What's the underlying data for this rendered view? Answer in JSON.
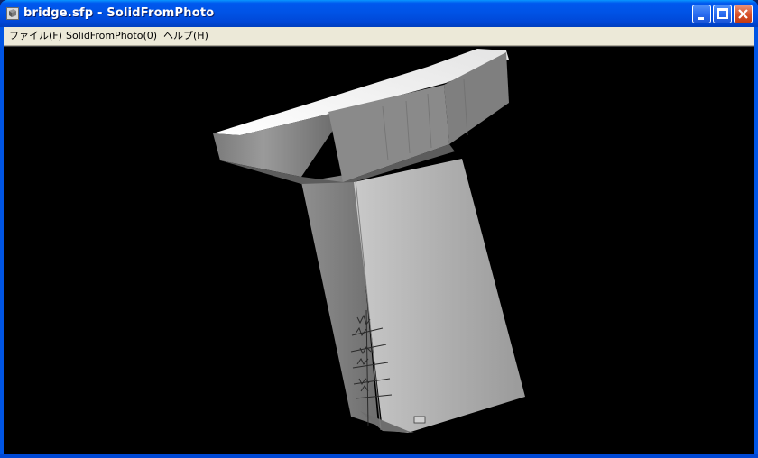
{
  "window": {
    "title": "bridge.sfp - SolidFromPhoto",
    "icon": "app-icon"
  },
  "caption_buttons": {
    "minimize": "minimize-icon",
    "maximize": "maximize-icon",
    "close": "close-icon"
  },
  "menu": {
    "items": [
      {
        "label": "ファイル(F)"
      },
      {
        "label": "SolidFromPhoto(0)"
      },
      {
        "label": "ヘルプ(H)"
      }
    ]
  },
  "viewport": {
    "background": "#000000",
    "content": "3d-bridge-pier-model"
  },
  "colors": {
    "titlebar": "#0058ee",
    "menubar": "#ece9d8",
    "close_button": "#d9532c"
  }
}
